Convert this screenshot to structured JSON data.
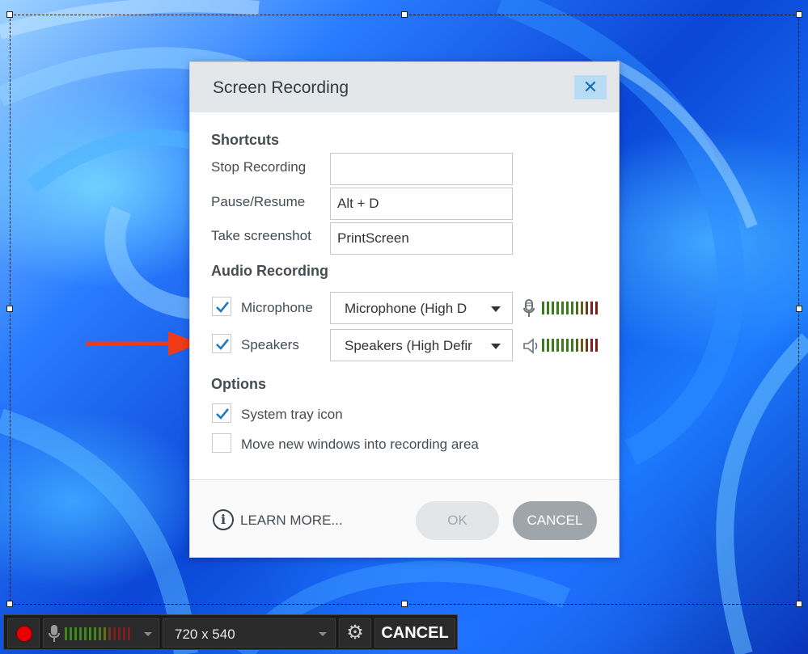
{
  "dialog": {
    "title": "Screen Recording",
    "close_icon": "close-icon",
    "close_glyph": "✕",
    "shortcuts": {
      "heading": "Shortcuts",
      "stop_label": "Stop Recording",
      "stop_value": "",
      "pause_label": "Pause/Resume",
      "pause_value": "Alt + D",
      "screenshot_label": "Take screenshot",
      "screenshot_value": "PrintScreen"
    },
    "audio": {
      "heading": "Audio Recording",
      "microphone_label": "Microphone",
      "microphone_checked": true,
      "microphone_device": "Microphone (High D",
      "speakers_label": "Speakers",
      "speakers_checked": true,
      "speakers_device": "Speakers (High Defir"
    },
    "options": {
      "heading": "Options",
      "tray_label": "System tray icon",
      "tray_checked": true,
      "move_label": "Move new windows into recording area",
      "move_checked": false
    },
    "footer": {
      "learn_more": "LEARN MORE...",
      "info_glyph": "i",
      "ok": "OK",
      "cancel": "CANCEL"
    }
  },
  "toolbar": {
    "size": "720 x 540",
    "gear_glyph": "⚙",
    "cancel": "CANCEL"
  },
  "colors": {
    "accent_check": "#1e79c2",
    "close_bg": "#b8dcf3",
    "record_red": "#e80000",
    "arrow_red": "#f03a17",
    "meter_green": "#3c7a1e",
    "meter_red": "#7a1e1e"
  }
}
